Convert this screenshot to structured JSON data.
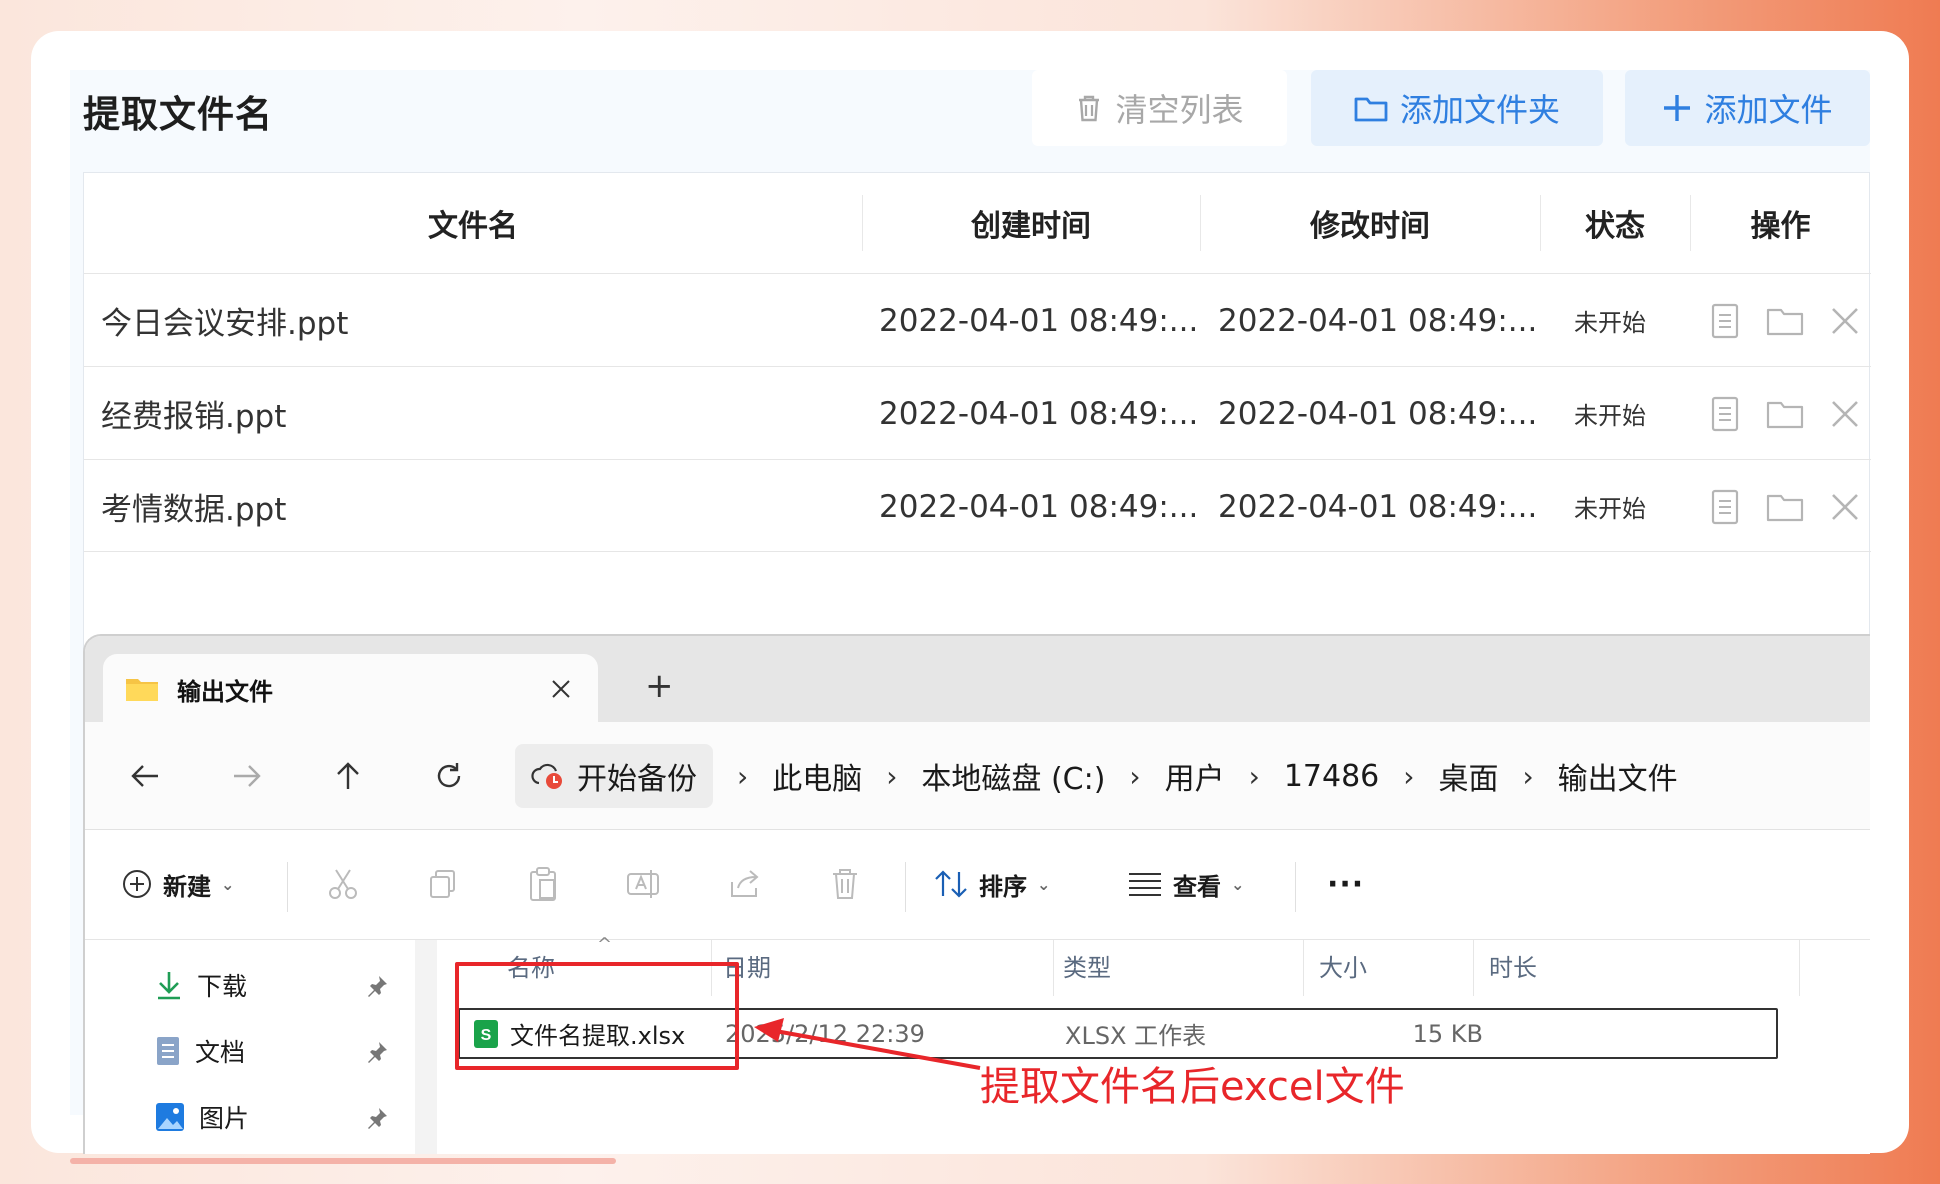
{
  "app": {
    "title": "提取文件名",
    "buttons": {
      "clear": "清空列表",
      "add_folder": "添加文件夹",
      "add_file": "添加文件"
    },
    "table": {
      "headers": [
        "文件名",
        "创建时间",
        "修改时间",
        "状态",
        "操作"
      ],
      "rows": [
        {
          "name": "今日会议安排.ppt",
          "created": "2022-04-01 08:49:...",
          "modified": "2022-04-01 08:49:...",
          "status": "未开始"
        },
        {
          "name": "经费报销.ppt",
          "created": "2022-04-01 08:49:...",
          "modified": "2022-04-01 08:49:...",
          "status": "未开始"
        },
        {
          "name": "考情数据.ppt",
          "created": "2022-04-01 08:49:...",
          "modified": "2022-04-01 08:49:...",
          "status": "未开始"
        }
      ],
      "row_action_icons": [
        "document-icon",
        "folder-icon",
        "close-icon"
      ]
    }
  },
  "explorer": {
    "tab": {
      "title": "输出文件",
      "new_tab": "+"
    },
    "breadcrumb": {
      "backup": "开始备份",
      "items": [
        "此电脑",
        "本地磁盘 (C:)",
        "用户",
        "17486",
        "桌面",
        "输出文件"
      ]
    },
    "commands": {
      "new": "新建",
      "sort": "排序",
      "view": "查看",
      "more": "···"
    },
    "sidebar": [
      {
        "label": "下载",
        "icon": "download-icon"
      },
      {
        "label": "文档",
        "icon": "document-icon"
      },
      {
        "label": "图片",
        "icon": "picture-icon"
      }
    ],
    "columns": [
      "名称",
      "日期",
      "类型",
      "大小",
      "时长"
    ],
    "file": {
      "name": "文件名提取.xlsx",
      "date": "2025/2/12 22:39",
      "type": "XLSX 工作表",
      "size": "15 KB"
    }
  },
  "annotation": {
    "text": "提取文件名后excel文件",
    "color": "#e8262a"
  },
  "colors": {
    "accent": "#2f7fe0",
    "accent_bg": "#e5f0fc"
  }
}
